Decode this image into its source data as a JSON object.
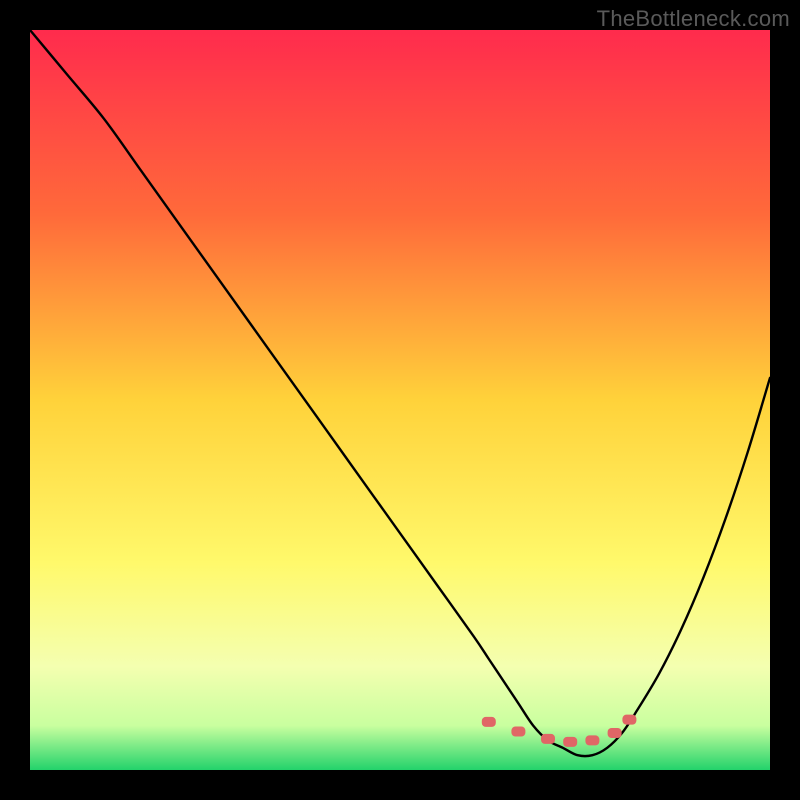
{
  "watermark": "TheBottleneck.com",
  "chart_data": {
    "type": "line",
    "title": "",
    "xlabel": "",
    "ylabel": "",
    "xlim": [
      0,
      100
    ],
    "ylim": [
      0,
      100
    ],
    "grid": false,
    "background_gradient": {
      "stops": [
        {
          "offset": 0,
          "color": "#ff2b4d"
        },
        {
          "offset": 25,
          "color": "#ff6a3a"
        },
        {
          "offset": 50,
          "color": "#ffd23a"
        },
        {
          "offset": 72,
          "color": "#fff96b"
        },
        {
          "offset": 86,
          "color": "#f4ffb0"
        },
        {
          "offset": 94,
          "color": "#c9ff9f"
        },
        {
          "offset": 100,
          "color": "#23d36b"
        }
      ]
    },
    "series": [
      {
        "name": "bottleneck-curve",
        "color": "#000000",
        "x": [
          0,
          5,
          10,
          15,
          20,
          25,
          30,
          35,
          40,
          45,
          50,
          55,
          60,
          62,
          64,
          66,
          68,
          70,
          72,
          74,
          76,
          78,
          80,
          82,
          85,
          88,
          91,
          94,
          97,
          100
        ],
        "y": [
          100,
          94,
          88,
          81,
          74,
          67,
          60,
          53,
          46,
          39,
          32,
          25,
          18,
          15,
          12,
          9,
          6,
          4,
          3,
          2,
          2,
          3,
          5,
          8,
          13,
          19,
          26,
          34,
          43,
          53
        ]
      }
    ],
    "markers": {
      "name": "optimal-range",
      "color": "#e06666",
      "points": [
        {
          "x": 62,
          "y": 6.5
        },
        {
          "x": 66,
          "y": 5.2
        },
        {
          "x": 70,
          "y": 4.2
        },
        {
          "x": 73,
          "y": 3.8
        },
        {
          "x": 76,
          "y": 4.0
        },
        {
          "x": 79,
          "y": 5.0
        },
        {
          "x": 81,
          "y": 6.8
        }
      ]
    }
  }
}
